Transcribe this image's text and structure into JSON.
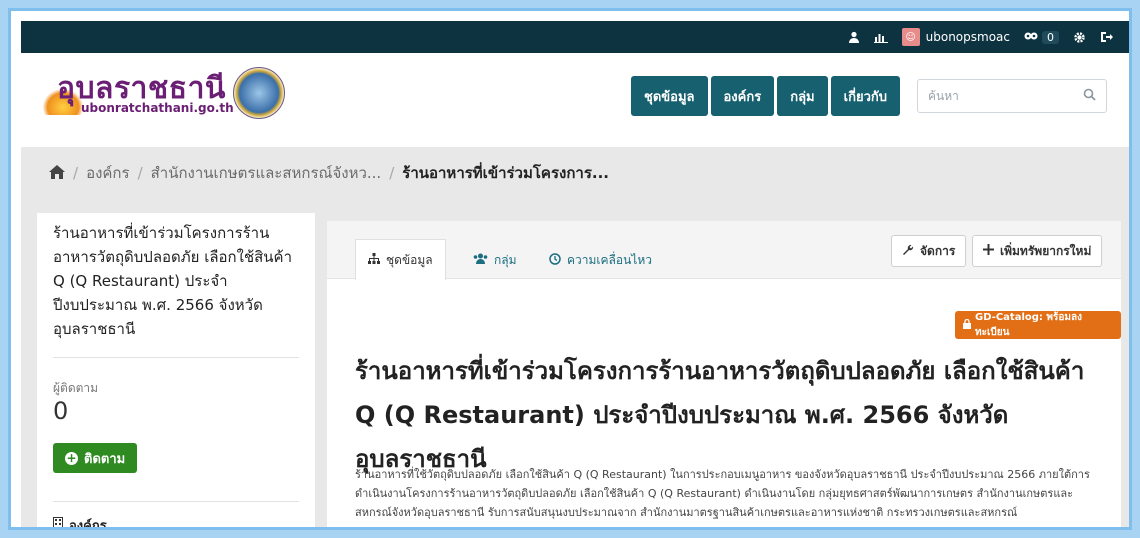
{
  "masthead": {
    "user_name": "ubonopsmoac",
    "activity_count": "0",
    "icons": [
      "user-icon",
      "dashboard-icon",
      "avatar",
      "activity-icon",
      "settings-icon",
      "logout-icon"
    ]
  },
  "header": {
    "logo_text": "อุบลราชธานี",
    "logo_url": "ubonratchathani.go.th",
    "nav": [
      "ชุดข้อมูล",
      "องค์กร",
      "กลุ่ม",
      "เกี่ยวกับ"
    ],
    "search_placeholder": "ค้นหา"
  },
  "breadcrumb": {
    "items": [
      "องค์กร",
      "สำนักงานเกษตรและสหกรณ์จังหว...",
      "ร้านอาหารที่เข้าร่วมโครงการ..."
    ]
  },
  "sidebar": {
    "title": "ร้านอาหารที่เข้าร่วมโครงการร้านอาหารวัตถุดิบปลอดภัย เลือกใช้สินค้า Q (Q Restaurant) ประจำปีงบประมาณ พ.ศ. 2566 จังหวัดอุบลราชธานี",
    "followers_label": "ผู้ติดตาม",
    "followers_count": "0",
    "follow_button": "ติดตาม",
    "organization_heading": "องค์กร"
  },
  "main": {
    "tabs": [
      "ชุดข้อมูล",
      "กลุ่ม",
      "ความเคลื่อนไหว"
    ],
    "manage_button": "จัดการ",
    "add_resource_button": "เพิ่มทรัพยากรใหม่",
    "catalog_badge": "GD-Catalog: พร้อมลงทะเบียน",
    "title": "ร้านอาหารที่เข้าร่วมโครงการร้านอาหารวัตถุดิบปลอดภัย เลือกใช้สินค้า Q (Q Restaurant) ประจำปีงบประมาณ พ.ศ. 2566 จังหวัดอุบลราชธานี",
    "description": "ร้านอาหารที่ใช้วัตถุดิบปลอดภัย เลือกใช้สินค้า Q (Q Restaurant) ในการประกอบเมนูอาหาร ของจังหวัดอุบลราชธานี ประจำปีงบประมาณ 2566 ภายใต้การดำเนินงานโครงการร้านอาหารวัตถุดิบปลอดภัย เลือกใช้สินค้า Q (Q Restaurant) ดำเนินงานโดย กลุ่มยุทธศาสตร์พัฒนาการเกษตร สำนักงานเกษตรและสหกรณ์จังหวัดอุบลราชธานี รับการสนับสนุนงบประมาณจาก สำนักงานมาตรฐานสินค้าเกษตรและอาหารแห่งชาติ กระทรวงเกษตรและสหกรณ์"
  },
  "colors": {
    "masthead": "#0e3340",
    "nav_button": "#16606f",
    "follow_button": "#2f8a22",
    "catalog_badge": "#e26f16",
    "link": "#1a6e80"
  }
}
